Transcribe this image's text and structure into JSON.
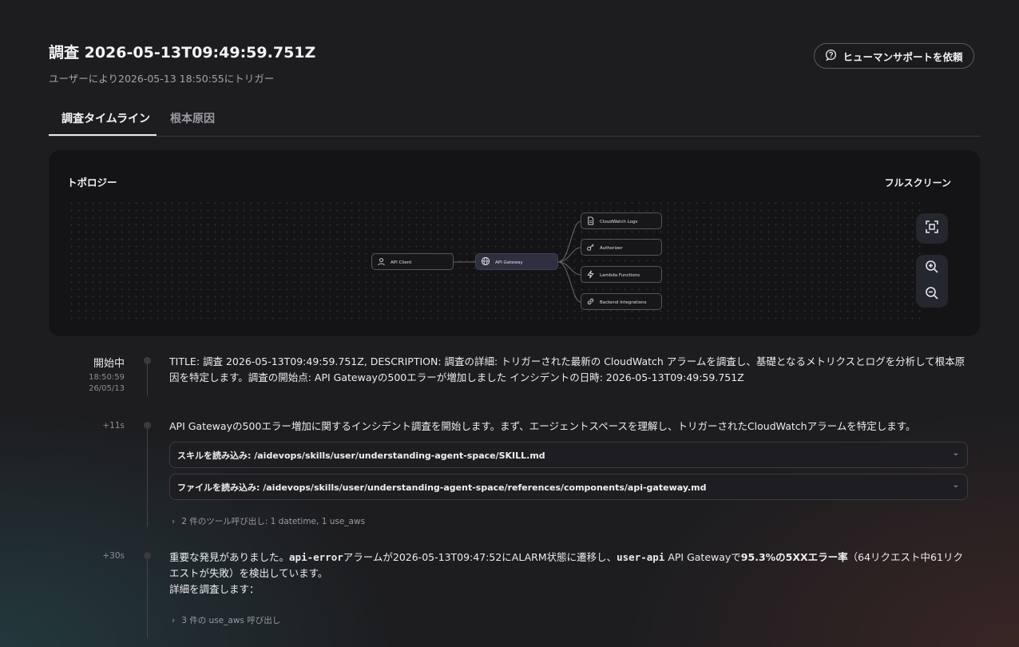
{
  "header": {
    "title": "調査 2026-05-13T09:49:59.751Z",
    "subtitle": "ユーザーにより2026-05-13 18:50:55にトリガー",
    "help_button": "ヒューマンサポートを依頼"
  },
  "tabs": [
    {
      "label": "調査タイムライン",
      "active": true
    },
    {
      "label": "根本原因",
      "active": false
    }
  ],
  "topology": {
    "title": "トポロジー",
    "fullscreen": "フルスクリーン",
    "nodes": {
      "client": "API Client",
      "gateway": "API Gateway",
      "logs": "CloudWatch Logs",
      "authorizer": "Authorizer",
      "lambda": "Lambda Functions",
      "backend": "Backend Integrations"
    },
    "controls": [
      "fit-view-icon",
      "zoom-in-icon",
      "zoom-out-icon"
    ]
  },
  "timeline": {
    "entry1": {
      "status": "開始中",
      "time": "18:50:59",
      "date": "26/05/13",
      "text": "TITLE: 調査 2026-05-13T09:49:59.751Z, DESCRIPTION: 調査の詳細: トリガーされた最新の CloudWatch アラームを調査し、基礎となるメトリクスとログを分析して根本原因を特定します。調査の開始点: API Gatewayの500エラーが増加しました インシデントの日時: 2026-05-13T09:49:59.751Z"
    },
    "entry2": {
      "offset": "+11s",
      "text": "API Gatewayの500エラー増加に関するインシデント調査を開始します。まず、エージェントスペースを理解し、トリガーされたCloudWatchアラームを特定します。",
      "acc1": "スキルを読み込み: /aidevops/skills/user/understanding-agent-space/SKILL.md",
      "acc2": "ファイルを読み込み: /aidevops/skills/user/understanding-agent-space/references/components/api-gateway.md",
      "tools": "2 件のツール呼び出し: 1 datetime, 1 use_aws"
    },
    "entry3": {
      "offset": "+30s",
      "p1": "重要な発見がありました。",
      "p2": "api-error",
      "p3": "アラームが2026-05-13T09:47:52にALARM状態に遷移し、",
      "p4": "user-api",
      "p5": " API Gatewayで",
      "p6": "95.3%の5XXエラー率",
      "p7": "（64リクエスト中61リクエストが失敗）を検出しています。",
      "p8": "詳細を調査します：",
      "tools": "3 件の use_aws 呼び出し"
    }
  }
}
